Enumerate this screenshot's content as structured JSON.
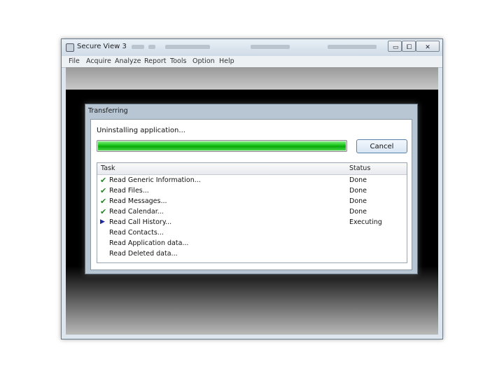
{
  "window": {
    "title": "Secure View 3",
    "controls": {
      "minimize": "▭",
      "maximize": "⧠",
      "close": "✕"
    }
  },
  "menu": [
    "File",
    "Acquire",
    "Analyze",
    "Report",
    "Tools",
    "Option",
    "Help"
  ],
  "dialog": {
    "title": "Transferring",
    "status": "Uninstalling application...",
    "progress": 1.0,
    "progress_color": "#16c116",
    "cancel_label": "Cancel",
    "columns": {
      "task": "Task",
      "status": "Status"
    },
    "tasks": [
      {
        "task": "Read Generic Information...",
        "status": "Done",
        "state": "done"
      },
      {
        "task": "Read Files...",
        "status": "Done",
        "state": "done"
      },
      {
        "task": "Read Messages...",
        "status": "Done",
        "state": "done"
      },
      {
        "task": "Read Calendar...",
        "status": "Done",
        "state": "done"
      },
      {
        "task": "Read Call History...",
        "status": "Executing",
        "state": "current"
      },
      {
        "task": "Read Contacts...",
        "status": "",
        "state": "pending"
      },
      {
        "task": "Read Application data...",
        "status": "",
        "state": "pending"
      },
      {
        "task": "Read Deleted data...",
        "status": "",
        "state": "pending"
      }
    ]
  },
  "icons": {
    "done": "check-icon",
    "current": "play-arrow-icon",
    "app": "app-icon"
  }
}
